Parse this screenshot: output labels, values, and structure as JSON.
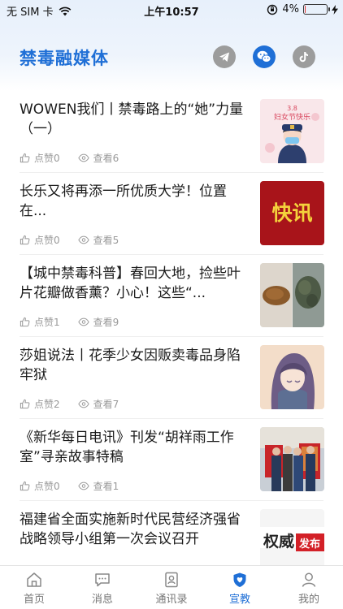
{
  "status_bar": {
    "carrier": "无 SIM 卡",
    "time": "上午10:57",
    "battery": "4%",
    "battery_level": 0.04
  },
  "header": {
    "title": "禁毒融媒体",
    "share_icons": [
      "telegram-icon",
      "wechat-icon",
      "tiktok-icon"
    ]
  },
  "feed": [
    {
      "title": "WOWEN我们丨禁毒路上的“她”力量（一）",
      "likes_label": "点赞0",
      "views_label": "查看6",
      "thumb_text": "3.8 妇女节快乐"
    },
    {
      "title": "长乐又将再添一所优质大学！位置在...",
      "likes_label": "点赞0",
      "views_label": "查看5",
      "thumb_text": "快讯"
    },
    {
      "title": "【城中禁毒科普】春回大地，捡些叶片花瓣做香薰？小心！这些“...",
      "likes_label": "点赞1",
      "views_label": "查看9",
      "thumb_text": ""
    },
    {
      "title": "莎姐说法丨花季少女因贩卖毒品身陷牢狱",
      "likes_label": "点赞2",
      "views_label": "查看7",
      "thumb_text": ""
    },
    {
      "title": "《新华每日电讯》刊发“胡祥雨工作室”寻亲故事特稿",
      "likes_label": "点赞0",
      "views_label": "查看1",
      "thumb_text": ""
    },
    {
      "title": "福建省全面实施新时代民营经济强省战略领导小组第一次会议召开",
      "likes_label": "",
      "views_label": "",
      "thumb_text": "权威发布"
    }
  ],
  "tabbar": {
    "tabs": [
      {
        "label": "首页",
        "icon": "home-icon",
        "active": false
      },
      {
        "label": "消息",
        "icon": "message-icon",
        "active": false
      },
      {
        "label": "通讯录",
        "icon": "contacts-icon",
        "active": false
      },
      {
        "label": "宣教",
        "icon": "heart-shield-icon",
        "active": true
      },
      {
        "label": "我的",
        "icon": "profile-icon",
        "active": false
      }
    ]
  },
  "colors": {
    "accent": "#1f6fd6",
    "muted": "#999999",
    "battery_low": "#e53935"
  }
}
